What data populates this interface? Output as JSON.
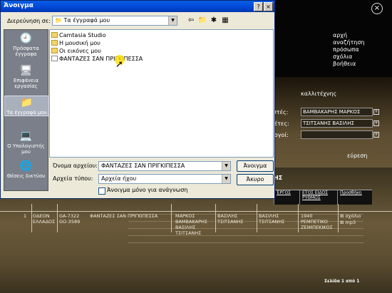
{
  "app": {
    "nav": [
      "αρχή",
      "αναζήτηση",
      "πρόσωπα",
      "σχόλια",
      "βοήθεια"
    ],
    "artist_head": "καλλιτέχνης",
    "fields": [
      {
        "label": "ιστές:",
        "value": "ΒΑΜΒΑΚΑΡΗΣ ΜΑΡΚΟΣ"
      },
      {
        "label": "θέτες:",
        "value": "ΤΣΙΤΣΑΝΗΣ ΒΑΣΙΛΗΣ"
      },
      {
        "label": "υργοί:",
        "value": ""
      }
    ],
    "search_label": "εύρεση",
    "letters": "ΗΣ",
    "table": {
      "headers": [
        "ΈΡΓΟΣ",
        "ΕΤΟΣ ΕΙΔΟΣ ΡΥΘΜΟΣ",
        "Προσθήκη"
      ],
      "row": {
        "num": "1",
        "company": "ΟΔΕΟΝ ΕΛΛΑΔΟΣ",
        "catalog": "GA-7322 GO-3589",
        "title": "ΦΑΝΤΑΖΕΣ ΣΑΝ ΠΡΙΓΚΙΠΕΣΣΑ",
        "singers": "ΜΑΡΚΟΣ ΒΑΜΒΑΚΑΡΗΣ ΒΑΣΙΛΗΣ ΤΣΙΤΣΑΝΗΣ",
        "composer": "ΒΑΣΙΛΗΣ ΤΣΙΤΣΑΝΗΣ",
        "lyricist": "ΒΑΣΙΛΗΣ ΤΣΙΤΣΑΝΗΣ",
        "year_genre": "1940 ΡΕΜΠΕΤΙΚΟ ΖΕΙΜΠΕΚΙΚΟΣ",
        "add": [
          "σχόλιο",
          "mp3"
        ]
      }
    },
    "pager": "Σελίδα 1 από 1",
    "close_glyph": "×"
  },
  "dialog": {
    "title": "Άνοιγμα",
    "lookin_label": "Διερεύνηση σε:",
    "lookin_value": "Τα έγγραφά μου",
    "places": [
      {
        "label": "Πρόσφατα έγγραφα",
        "icon": "recent-docs-icon",
        "glyph": "🕘"
      },
      {
        "label": "Επιφάνεια εργασίας",
        "icon": "desktop-icon",
        "glyph": "🖥"
      },
      {
        "label": "Τα έγγραφά μου",
        "icon": "my-documents-icon",
        "glyph": "📁"
      },
      {
        "label": "Ο Υπολογιστής μου",
        "icon": "my-computer-icon",
        "glyph": "💻"
      },
      {
        "label": "Θέσεις δικτύου",
        "icon": "network-icon",
        "glyph": "🌐"
      }
    ],
    "files": [
      {
        "name": "Camtasia Studio",
        "type": "folder"
      },
      {
        "name": "Η μουσική μου",
        "type": "folder"
      },
      {
        "name": "Οι εικόνες μου",
        "type": "folder"
      },
      {
        "name": "ΦΑΝΤΑΖΕΣ ΣΑΝ ΠΡΙΓΚΙΠΕΣΣΑ",
        "type": "file"
      }
    ],
    "filename_label": "Όνομα αρχείου:",
    "filename_value": "ΦΑΝΤΑΖΕΣ ΣΑΝ ΠΡΙΓΚΙΠΕΣΣΑ",
    "filetype_label": "Αρχεία τύπου:",
    "filetype_value": "Αρχεία ήχου",
    "open_button": "Άνοιγμα",
    "cancel_button": "Άκυρο",
    "readonly_label": "Άνοιγμα μόνο για ανάγνωση",
    "help_glyph": "?",
    "close_glyph": "×",
    "combo_arrow": "▼",
    "tools": {
      "back": "⇦",
      "up": "📁",
      "new_folder": "✱",
      "views": "▦"
    }
  },
  "colors": {
    "titlebar": "#0058e6",
    "dialog_bg": "#ece9d8",
    "highlight": "#ffe100"
  }
}
